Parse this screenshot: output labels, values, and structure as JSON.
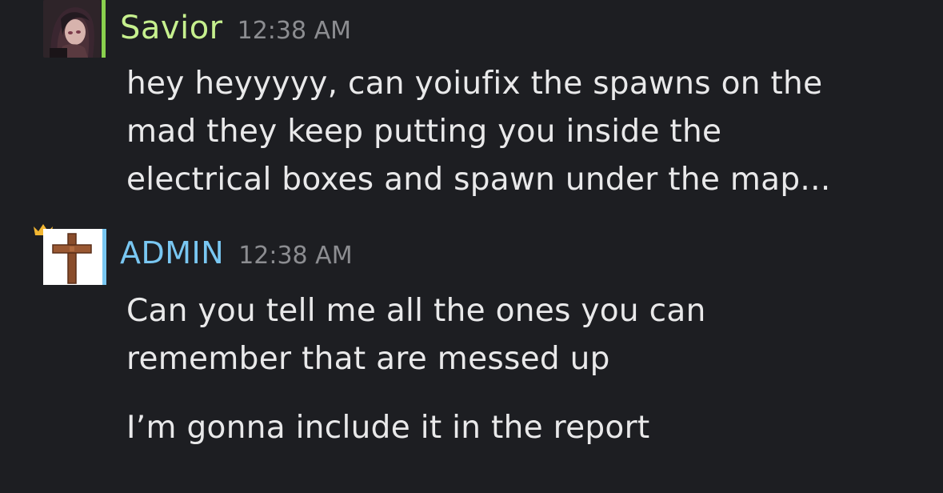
{
  "messages": [
    {
      "author": "Savior",
      "author_color": "#c6f08e",
      "status_color": "#8ad04e",
      "time": "12:38 AM",
      "lines": [
        "hey heyyyyy, can yoiufix the spawns on the",
        "mad they keep putting you inside the",
        "electrical boxes and spawn under the map..."
      ]
    },
    {
      "author": "ADMIN",
      "author_color": "#79c7f2",
      "status_color": "#79c7f2",
      "time": "12:38 AM",
      "crown_icon": "crown-icon",
      "lines": [
        "Can you tell me all the ones you can",
        "remember that are messed up",
        "I’m gonna include it in the report"
      ]
    }
  ]
}
